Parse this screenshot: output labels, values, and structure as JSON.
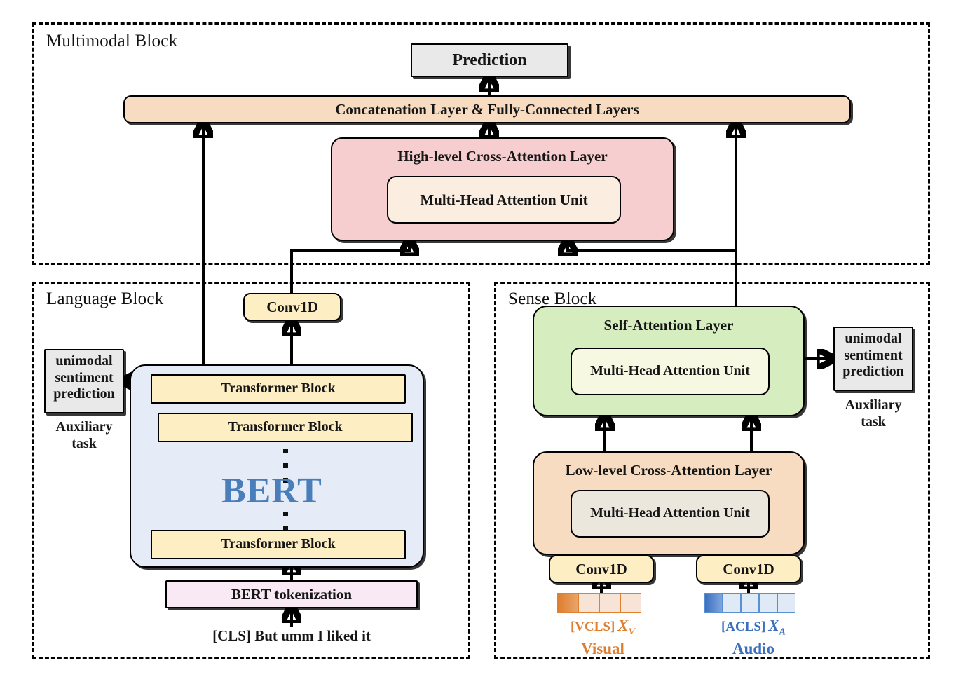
{
  "figure": {
    "type": "architecture-diagram",
    "title": "Multimodal sentiment analysis architecture"
  },
  "blocks": {
    "multimodal": {
      "title": "Multimodal Block"
    },
    "language": {
      "title": "Language Block"
    },
    "sense": {
      "title": "Sense Block"
    }
  },
  "multimodal": {
    "prediction": "Prediction",
    "concat": "Concatenation Layer  &  Fully-Connected Layers",
    "high_cross_attention": "High-level Cross-Attention Layer",
    "high_mha": "Multi-Head Attention Unit"
  },
  "language": {
    "conv1d": "Conv1D",
    "transformer_1": "Transformer Block",
    "transformer_2": "Transformer Block",
    "transformer_3": "Transformer Block",
    "bert": "BERT",
    "tokenization": "BERT tokenization",
    "input_text": "[CLS] But umm I liked it",
    "aux_box": "unimodal\nsentiment\nprediction",
    "aux_box_lines": [
      "unimodal",
      "sentiment",
      "prediction"
    ],
    "aux_caption_lines": [
      "Auxiliary",
      "task"
    ]
  },
  "sense": {
    "self_attention": "Self-Attention Layer",
    "self_mha": "Multi-Head Attention Unit",
    "low_cross_attention": "Low-level Cross-Attention Layer",
    "low_mha": "Multi-Head Attention Unit",
    "conv1d_visual": "Conv1D",
    "conv1d_audio": "Conv1D",
    "aux_box_lines": [
      "unimodal",
      "sentiment",
      "prediction"
    ],
    "aux_caption_lines": [
      "Auxiliary",
      "task"
    ],
    "visual": {
      "cls_token": "[VCLS]",
      "symbol": "X",
      "symbol_sub": "V",
      "name": "Visual",
      "cells": 4,
      "color": "#de7e2e"
    },
    "audio": {
      "cls_token": "[ACLS]",
      "symbol": "X",
      "symbol_sub": "A",
      "name": "Audio",
      "cells": 5,
      "color": "#3a6fc0"
    }
  },
  "colors": {
    "prediction_fill": "#e9e9e9",
    "concat_fill": "#f7dcc2",
    "high_cross_fill": "#f6ced0",
    "high_mha_fill": "#fbeee1",
    "self_attention_fill": "#d6edc0",
    "self_mha_fill": "#f6f8e2",
    "low_cross_fill": "#f7dcc2",
    "low_mha_fill": "#ece7dc",
    "conv1d_fill": "#fdeec3",
    "bert_container_fill": "#e6ecf7",
    "transformer_fill": "#fdeec3",
    "tokenization_fill": "#f9e9f5",
    "bert_text": "#4a7ebb",
    "visual_accent": "#de7e2e",
    "audio_accent": "#3a6fc0",
    "stroke": "#000000"
  }
}
